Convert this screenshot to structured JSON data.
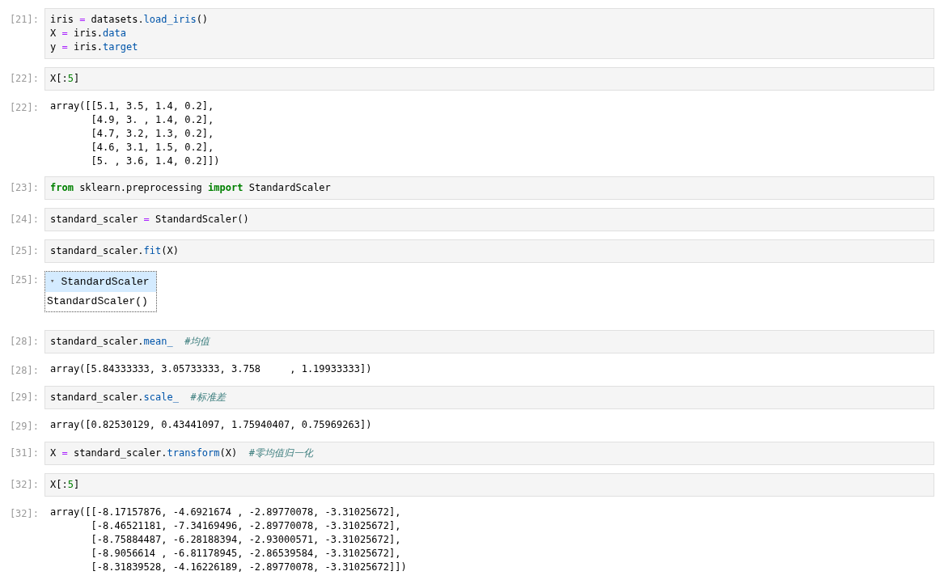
{
  "cells": [
    {
      "kind": "input",
      "prompt": "[21]:",
      "lines": [
        [
          {
            "text": "iris ",
            "kind": "plain"
          },
          {
            "text": "=",
            "kind": "op"
          },
          {
            "text": " datasets.",
            "kind": "plain"
          },
          {
            "text": "load_iris",
            "kind": "prop"
          },
          {
            "text": "()",
            "kind": "plain"
          }
        ],
        [
          {
            "text": "X ",
            "kind": "plain"
          },
          {
            "text": "=",
            "kind": "op"
          },
          {
            "text": " iris.",
            "kind": "plain"
          },
          {
            "text": "data",
            "kind": "prop"
          }
        ],
        [
          {
            "text": "y ",
            "kind": "plain"
          },
          {
            "text": "=",
            "kind": "op"
          },
          {
            "text": " iris.",
            "kind": "plain"
          },
          {
            "text": "target",
            "kind": "prop"
          }
        ]
      ]
    },
    {
      "kind": "input",
      "prompt": "[22]:",
      "lines": [
        [
          {
            "text": "X[:",
            "kind": "plain"
          },
          {
            "text": "5",
            "kind": "num"
          },
          {
            "text": "]",
            "kind": "plain"
          }
        ]
      ]
    },
    {
      "kind": "output",
      "prompt": "[22]:",
      "text": [
        "array([[5.1, 3.5, 1.4, 0.2],",
        "       [4.9, 3. , 1.4, 0.2],",
        "       [4.7, 3.2, 1.3, 0.2],",
        "       [4.6, 3.1, 1.5, 0.2],",
        "       [5. , 3.6, 1.4, 0.2]])"
      ]
    },
    {
      "kind": "input",
      "prompt": "[23]:",
      "lines": [
        [
          {
            "text": "from",
            "kind": "kw"
          },
          {
            "text": " sklearn.preprocessing ",
            "kind": "plain"
          },
          {
            "text": "import",
            "kind": "kw"
          },
          {
            "text": " StandardScaler",
            "kind": "plain"
          }
        ]
      ]
    },
    {
      "kind": "input",
      "prompt": "[24]:",
      "lines": [
        [
          {
            "text": "standard_scaler ",
            "kind": "plain"
          },
          {
            "text": "=",
            "kind": "op"
          },
          {
            "text": " StandardScaler()",
            "kind": "plain"
          }
        ]
      ]
    },
    {
      "kind": "input",
      "prompt": "[25]:",
      "lines": [
        [
          {
            "text": "standard_scaler.",
            "kind": "plain"
          },
          {
            "text": "fit",
            "kind": "prop"
          },
          {
            "text": "(X)",
            "kind": "plain"
          }
        ]
      ]
    },
    {
      "kind": "estimator",
      "prompt": "[25]:",
      "toggle": "▾",
      "title": "StandardScaler",
      "expanded": true,
      "body": "StandardScaler()"
    },
    {
      "kind": "input",
      "prompt": "[28]:",
      "lines": [
        [
          {
            "text": "standard_scaler.",
            "kind": "plain"
          },
          {
            "text": "mean_",
            "kind": "prop"
          },
          {
            "text": "  #均值",
            "kind": "comment"
          }
        ]
      ]
    },
    {
      "kind": "output",
      "prompt": "[28]:",
      "text": [
        "array([5.84333333, 3.05733333, 3.758     , 1.19933333])"
      ]
    },
    {
      "kind": "input",
      "prompt": "[29]:",
      "lines": [
        [
          {
            "text": "standard_scaler.",
            "kind": "plain"
          },
          {
            "text": "scale_",
            "kind": "prop"
          },
          {
            "text": "  #标准差",
            "kind": "comment"
          }
        ]
      ]
    },
    {
      "kind": "output",
      "prompt": "[29]:",
      "text": [
        "array([0.82530129, 0.43441097, 1.75940407, 0.75969263])"
      ]
    },
    {
      "kind": "input",
      "prompt": "[31]:",
      "lines": [
        [
          {
            "text": "X ",
            "kind": "plain"
          },
          {
            "text": "=",
            "kind": "op"
          },
          {
            "text": " standard_scaler.",
            "kind": "plain"
          },
          {
            "text": "transform",
            "kind": "prop"
          },
          {
            "text": "(X)  ",
            "kind": "plain"
          },
          {
            "text": "#零均值归一化",
            "kind": "comment"
          }
        ]
      ]
    },
    {
      "kind": "input",
      "prompt": "[32]:",
      "lines": [
        [
          {
            "text": "X[:",
            "kind": "plain"
          },
          {
            "text": "5",
            "kind": "num"
          },
          {
            "text": "]",
            "kind": "plain"
          }
        ]
      ]
    },
    {
      "kind": "output",
      "prompt": "[32]:",
      "text": [
        "array([[-8.17157876, -4.6921674 , -2.89770078, -3.31025672],",
        "       [-8.46521181, -7.34169496, -2.89770078, -3.31025672],",
        "       [-8.75884487, -6.28188394, -2.93000571, -3.31025672],",
        "       [-8.9056614 , -6.81178945, -2.86539584, -3.31025672],",
        "       [-8.31839528, -4.16226189, -2.89770078, -3.31025672]])"
      ]
    }
  ]
}
